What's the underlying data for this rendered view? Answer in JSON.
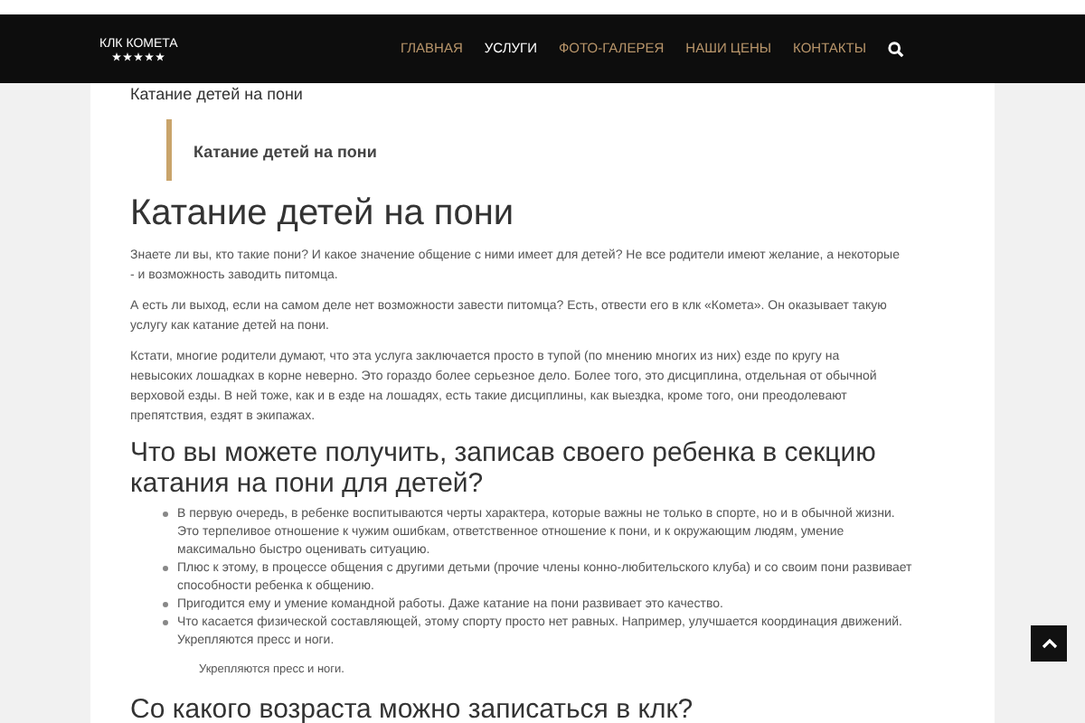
{
  "header": {
    "logo": "КЛК КОМЕТА",
    "stars": 5,
    "nav": [
      {
        "label": "ГЛАВНАЯ",
        "selected": false
      },
      {
        "label": "УСЛУГИ",
        "selected": true
      },
      {
        "label": "ФОТО-ГАЛЕРЕЯ",
        "selected": false
      },
      {
        "label": "НАШИ ЦЕНЫ",
        "selected": false
      },
      {
        "label": "КОНТАКТЫ",
        "selected": false
      }
    ]
  },
  "page_title": "Катание детей на пони",
  "quote": "Катание детей на пони",
  "heading": "Катание детей на пони",
  "paragraphs": [
    "Знаете ли вы, кто такие пони? И какое значение общение с ними имеет для детей? Не все родители имеют желание, а некоторые - и возможность заводить питомца.",
    "А есть ли выход, если на самом деле нет возможности завести питомца? Есть, отвести его в клк «Комета». Он оказывает такую услугу как катание детей на пони.",
    "Кстати, многие родители думают, что эта услуга заключается просто в тупой (по мнению многих из них) езде по кругу на невысоких лошадках в корне неверно. Это гораздо более серьезное дело. Более того, это дисциплина, отдельная от обычной верховой езды. В ней тоже, как и в езде на лошадях, есть такие дисциплины, как выездка, кроме того, они преодолевают препятствия, ездят в экипажах."
  ],
  "subheading": "Что вы можете получить, записав своего ребенка в секцию катания на пони для детей?",
  "bullets": [
    "В первую очередь, в ребенке воспитываются черты характера, которые важны не только в спорте, но и в обычной жизни. Это терпеливое отношение к чужим ошибкам, ответственное отношение к пони, и к окружающим людям, умение максимально быстро оценивать ситуацию.",
    "Плюс к этому, в процессе общения с другими детьми (прочие члены конно-любительского клуба) и со своим пони развивает способности ребенка к общению.",
    "Пригодится ему и умение командной работы. Даже катание на пони развивает это качество.",
    "Что касается физической составляющей, этому спорту просто нет равных. Например, улучшается координация движений. Укрепляются пресс и ноги."
  ],
  "bullet_tail": "Укрепляются пресс и ноги.",
  "subheading_2": "Со какого возраста можно записаться в клк?"
}
